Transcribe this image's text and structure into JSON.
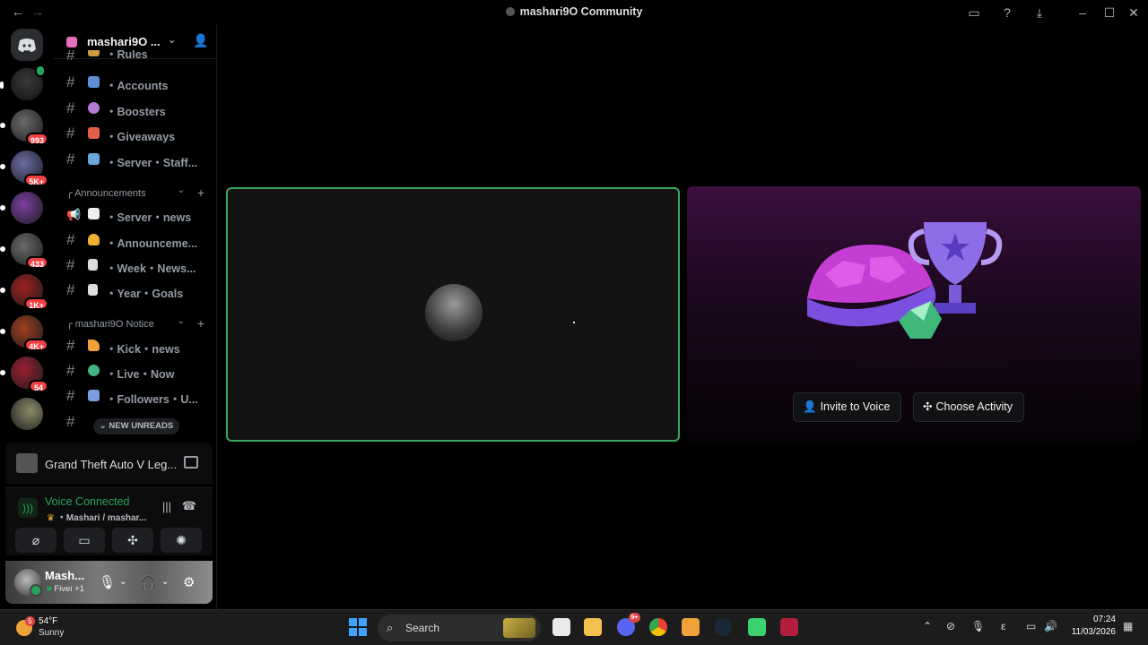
{
  "window": {
    "title": "mashari9O Community",
    "back_icon": "arrow-left-icon",
    "forward_icon": "arrow-right-icon"
  },
  "server": {
    "name": "mashari9O ...",
    "channels_top": [
      {
        "name": "・Rules",
        "emoji": "book",
        "color": "#c94"
      },
      {
        "name": "・Accounts",
        "emoji": "people",
        "color": "#5b8fd6"
      },
      {
        "name": "・Boosters",
        "emoji": "booster",
        "color": "#b47cd6"
      },
      {
        "name": "・Giveaways",
        "emoji": "gift",
        "color": "#e0604a"
      },
      {
        "name": "・Server・Staff...",
        "emoji": "laptop",
        "color": "#6aa7d8"
      }
    ],
    "category_announcements": "Announcements",
    "channels_announcements": [
      {
        "name": "・Server・news",
        "emoji": "memo",
        "color": "#eee",
        "icon": "megaphone"
      },
      {
        "name": "・Announceme...",
        "emoji": "bell",
        "color": "#f0b232"
      },
      {
        "name": "・Week・News...",
        "emoji": "page",
        "color": "#ddd"
      },
      {
        "name": "・Year・Goals",
        "emoji": "page",
        "color": "#ddd"
      }
    ],
    "category_notice": "mashari9O Notice",
    "channels_notice": [
      {
        "name": "・Kick・news",
        "emoji": "party",
        "color": "#f0a23a"
      },
      {
        "name": "・Live・Now",
        "emoji": "green-circle",
        "color": "#43b581"
      },
      {
        "name": "・Followers・U...",
        "emoji": "chart",
        "color": "#7a9ee0"
      }
    ],
    "new_unreads": "NEW UNREADS"
  },
  "guild_badges": [
    "993",
    "5K+",
    "433",
    "1K+",
    "4K+",
    "54"
  ],
  "activity": {
    "game": "Grand Theft Auto V Leg..."
  },
  "voice": {
    "status": "Voice Connected",
    "channel": "・Mashari / mashar..."
  },
  "user": {
    "name": "Mash...",
    "status": "Fivei +1"
  },
  "stage": {
    "invite_label": "Invite to Voice",
    "activity_label": "Choose Activity"
  },
  "taskbar": {
    "weather_temp": "54°F",
    "weather_cond": "Sunny",
    "weather_badge": "5",
    "search_label": "Search",
    "discord_badge": "9+",
    "time": "07:24",
    "date": "11/03/2026",
    "lang": "ε"
  },
  "colors": {
    "voice_green": "#23a55a",
    "badge_red": "#f23f43",
    "speaking_border": "#3ba55c"
  }
}
